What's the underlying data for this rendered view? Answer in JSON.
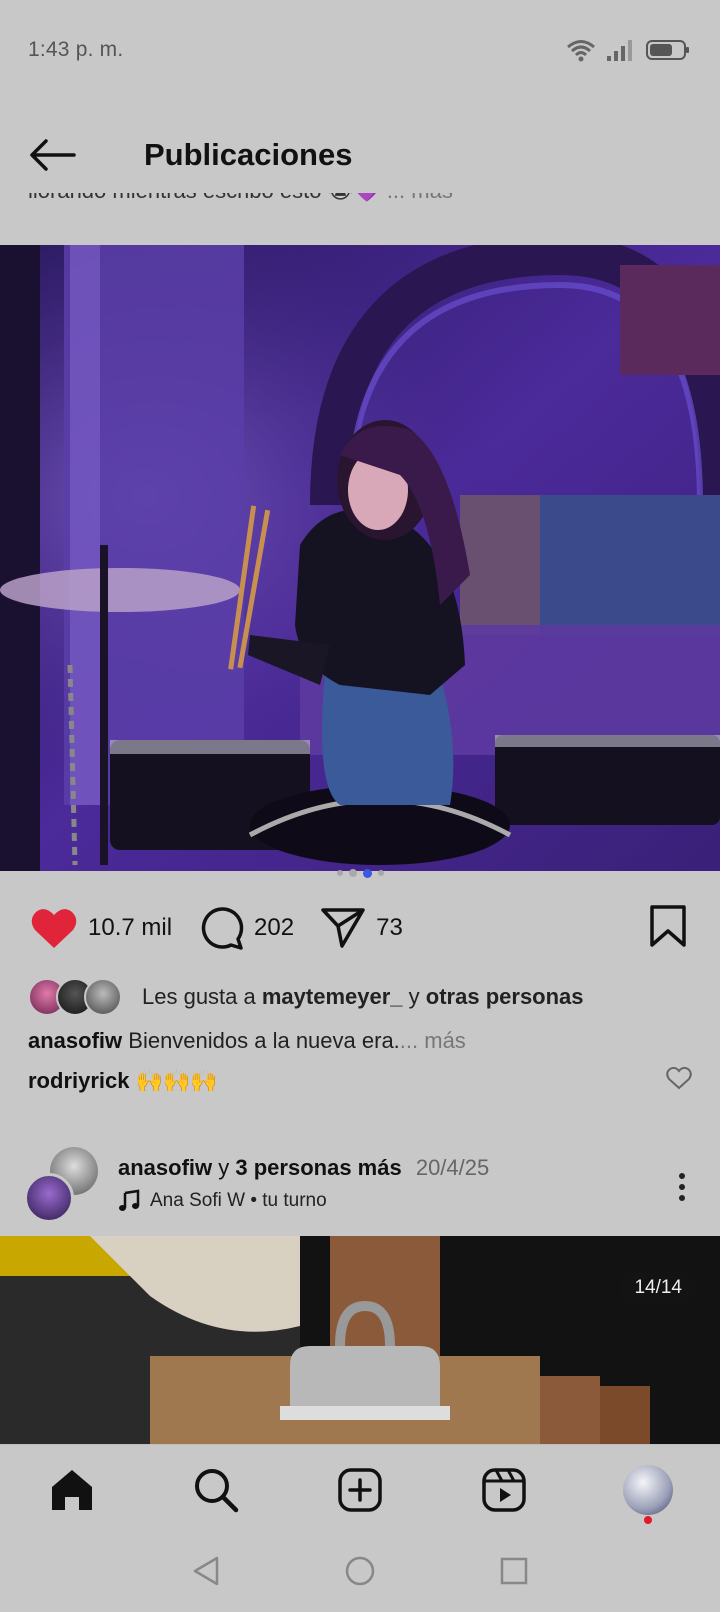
{
  "status_bar": {
    "time": "1:43 p. m."
  },
  "header": {
    "title": "Publicaciones"
  },
  "previous_post": {
    "caption_fragment": "llorando mientras escribo esto 😭💜",
    "more_label": "... más"
  },
  "post": {
    "photo_alt": "Woman with drumsticks at a drum kit under purple lights",
    "carousel": {
      "count": 4,
      "active_index": 2
    },
    "likes_count": "10.7 mil",
    "comments_count": "202",
    "shares_count": "73",
    "likes_line": {
      "prefix": "Les gusta a",
      "user": "maytemeyer_",
      "connector": "y",
      "suffix": "otras personas"
    },
    "caption": {
      "user": "anasofiw",
      "text": "Bienvenidos a la nueva era.",
      "more_label": "... más"
    },
    "comment": {
      "user": "rodriyrick",
      "text": "🙌🙌🙌"
    }
  },
  "next_post": {
    "author": "anasofiw",
    "connector": "y",
    "coauthors": "3 personas más",
    "date": "20/4/25",
    "music": "Ana Sofi W • tu turno",
    "counter": "14/14"
  },
  "icons": {
    "heart": "heart-filled-icon",
    "comment": "comment-bubble-icon",
    "share": "paper-plane-icon",
    "save": "bookmark-icon"
  },
  "colors": {
    "like": "#e0243a",
    "active_dot": "#3a57e8",
    "background": "#c8c8c8"
  }
}
